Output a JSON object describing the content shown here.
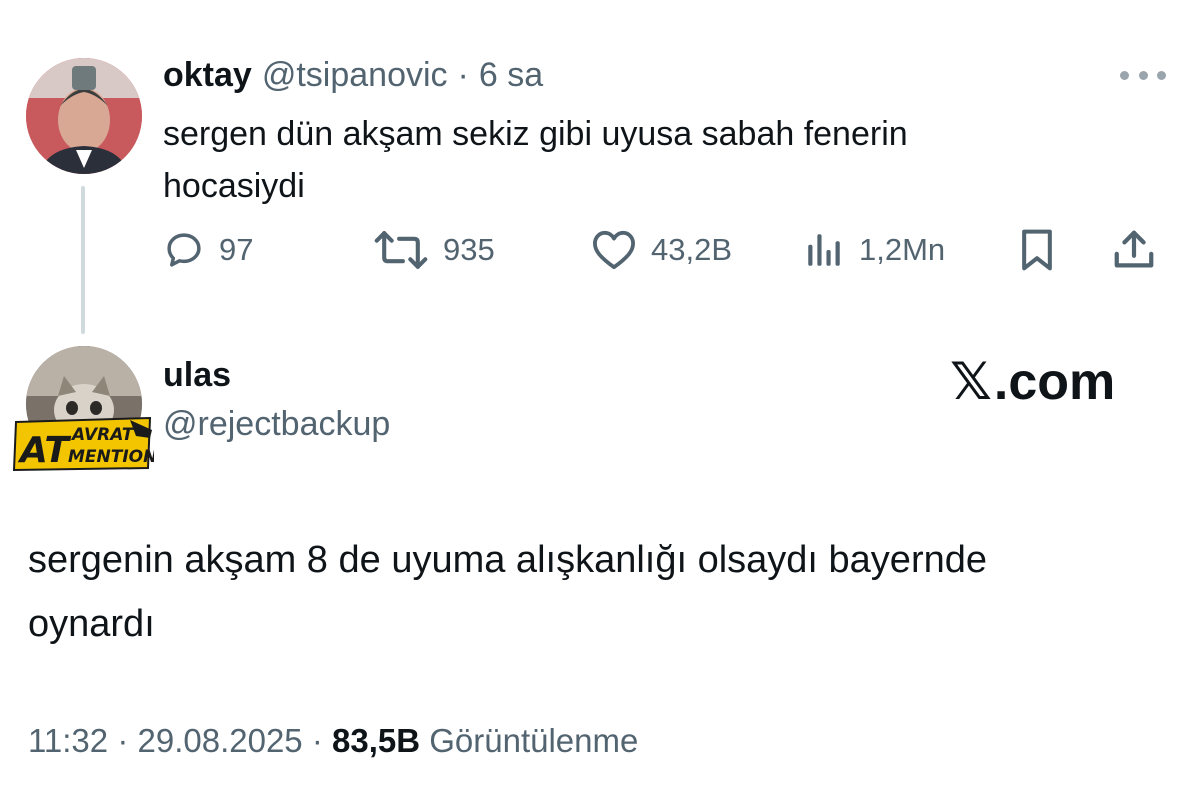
{
  "parent_tweet": {
    "display_name": "oktay",
    "handle": "@tsipanovic",
    "separator": "·",
    "time": "6 sa",
    "text_line_1": "sergen dün akşam sekiz gibi uyusa sabah fenerin",
    "text_line_2": "hocasiydi",
    "actions": {
      "replies": "97",
      "reposts": "935",
      "likes": "43,2B",
      "views": "1,2Mn"
    }
  },
  "main_tweet": {
    "display_name": "ulas",
    "handle": "@rejectbackup",
    "avatar_badge_text_1": "AT",
    "avatar_badge_text_2": "AVRAT",
    "avatar_badge_text_3": "MENTION",
    "text_line_1": "sergenin akşam 8 de uyuma alışkanlığı olsaydı bayernde",
    "text_line_2": "oynardı",
    "time": "11:32",
    "date": "29.08.2025",
    "separator": "·",
    "views_count": "83,5B",
    "views_label": "Görüntülenme"
  },
  "watermark": {
    "x_glyph": "𝕏",
    "text": ".com"
  },
  "colors": {
    "text": "#0f1419",
    "muted": "#536471",
    "thread_line": "#cfd9de",
    "badge_yellow": "#f2c500"
  },
  "icons": [
    "more-icon",
    "reply-icon",
    "repost-icon",
    "like-icon",
    "views-icon",
    "bookmark-icon",
    "share-icon"
  ]
}
